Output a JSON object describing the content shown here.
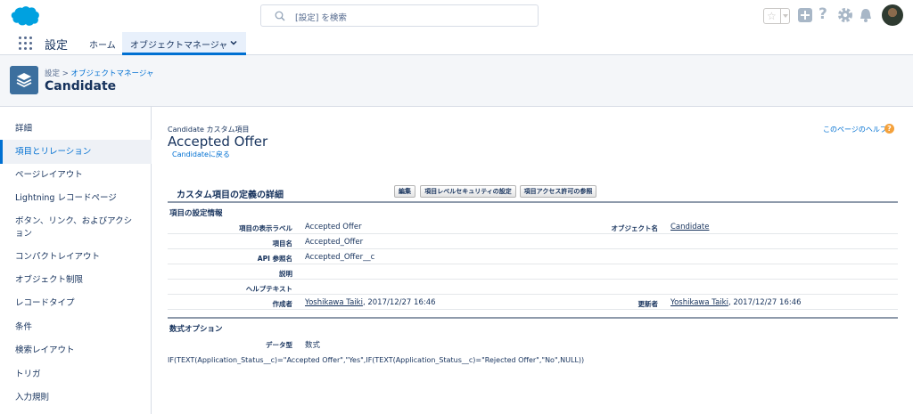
{
  "header": {
    "search_placeholder": "[設定] を検索",
    "icons": [
      "salesforce-cloud-logo",
      "search-icon",
      "star-icon",
      "plus-icon",
      "help-icon",
      "gear-icon",
      "bell-icon",
      "avatar"
    ]
  },
  "nav": {
    "app_name": "設定",
    "home": "ホーム",
    "active_tab": "オブジェクトマネージャ"
  },
  "page_header": {
    "breadcrumb_root": "設定",
    "breadcrumb_sep": " > ",
    "breadcrumb_link": "オブジェクトマネージャ",
    "object_name": "Candidate"
  },
  "sidebar": {
    "items": [
      "詳細",
      "項目とリレーション",
      "ページレイアウト",
      "Lightning レコードページ",
      "ボタン、リンク、およびアクション",
      "コンパクトレイアウト",
      "オブジェクト制限",
      "レコードタイプ",
      "条件",
      "検索レイアウト",
      "トリガ",
      "入力規則"
    ],
    "active_index": 1
  },
  "main": {
    "subtitle": "Candidate カスタム項目",
    "title": "Accepted Offer",
    "back_link": "Candidateに戻る",
    "help_link": "このページのヘルプ",
    "help_icon": "?",
    "section_title": "カスタム項目の定義の詳細",
    "buttons": {
      "edit": "編集",
      "field_security": "項目レベルセキュリティの設定",
      "field_access": "項目アクセス許可の参照"
    },
    "info_header": "項目の設定情報",
    "fields": {
      "label_label": "項目の表示ラベル",
      "label_value": "Accepted Offer",
      "object_label": "オブジェクト名",
      "object_value": "Candidate",
      "name_label": "項目名",
      "name_value": "Accepted_Offer",
      "api_label": "API 参照名",
      "api_value": "Accepted_Offer__c",
      "desc_label": "説明",
      "help_label": "ヘルプテキスト",
      "created_label": "作成者",
      "created_user": "Yoshikawa Taiki",
      "created_date": ", 2017/12/27 16:46",
      "modified_label": "更新者",
      "modified_user": "Yoshikawa Taiki",
      "modified_date": ", 2017/12/27 16:46"
    },
    "formula_header": "数式オプション",
    "data_type_label": "データ型",
    "data_type_value": "数式",
    "formula": "IF(TEXT(Application_Status__c)=\"Accepted Offer\",\"Yes\",IF(TEXT(Application_Status__c)=\"Rejected Offer\",\"No\",NULL))"
  }
}
